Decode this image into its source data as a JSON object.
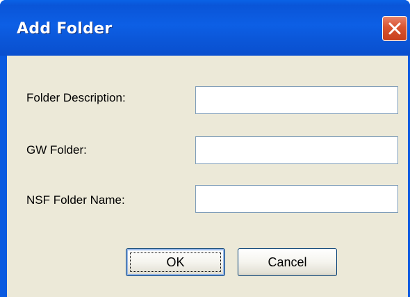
{
  "window": {
    "title": "Add Folder",
    "close_icon": "close-icon",
    "colors": {
      "titlebar": "#0a5ae0",
      "client": "#ece9d8",
      "close_button": "#d8532f"
    }
  },
  "form": {
    "fields": [
      {
        "label": "Folder Description:",
        "value": ""
      },
      {
        "label": "GW Folder:",
        "value": ""
      },
      {
        "label": "NSF Folder Name:",
        "value": ""
      }
    ]
  },
  "buttons": {
    "ok_label": "OK",
    "cancel_label": "Cancel"
  }
}
